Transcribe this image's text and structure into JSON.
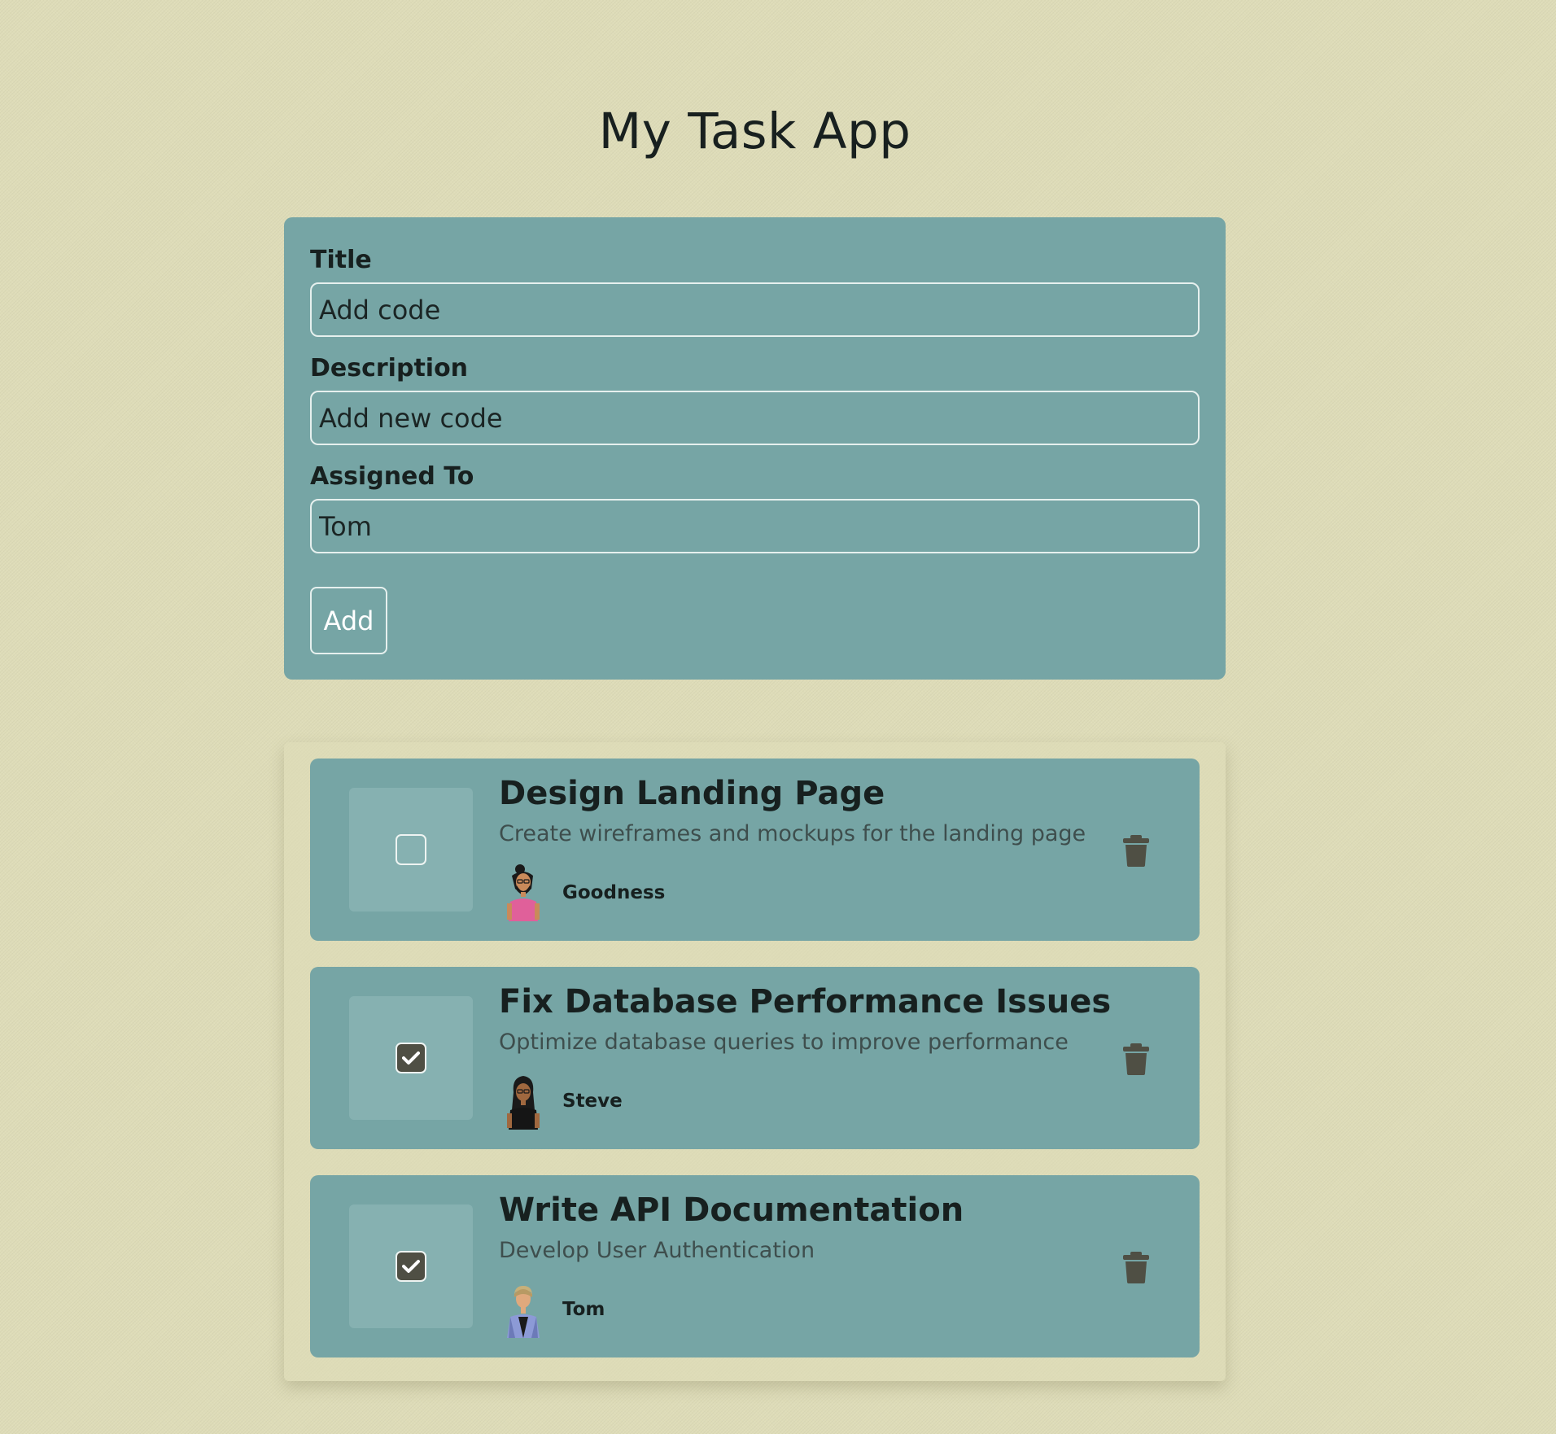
{
  "app": {
    "title": "My Task App"
  },
  "form": {
    "title_label": "Title",
    "title_value": "Add code",
    "description_label": "Description",
    "description_value": "Add new code",
    "assigned_label": "Assigned To",
    "assigned_value": "Tom",
    "add_button_label": "Add"
  },
  "tasks": [
    {
      "title": "Design Landing Page",
      "description": "Create wireframes and mockups for the landing page",
      "assignee": "Goodness",
      "completed": false,
      "avatar_icon": "avatar-goodness-icon"
    },
    {
      "title": "Fix Database Performance Issues",
      "description": "Optimize database queries to improve performance",
      "assignee": "Steve",
      "completed": true,
      "avatar_icon": "avatar-steve-icon"
    },
    {
      "title": "Write API Documentation",
      "description": "Develop User Authentication",
      "assignee": "Tom",
      "completed": true,
      "avatar_icon": "avatar-tom-icon"
    }
  ],
  "icons": {
    "checkmark": "checkmark-icon",
    "delete": "trash-icon"
  },
  "colors": {
    "background": "#dedcb8",
    "card": "#76a5a5",
    "check_tile": "#86b1b1",
    "checked_fill": "#4f4f44",
    "trash": "#4f4f44"
  }
}
